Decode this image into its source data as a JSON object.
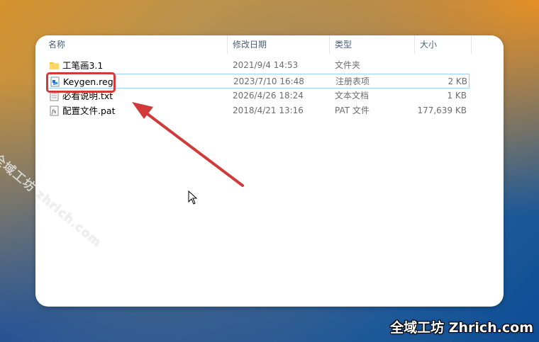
{
  "columns": {
    "name": "名称",
    "date_modified": "修改日期",
    "type": "类型",
    "size": "大小"
  },
  "files": [
    {
      "name": "工笔画3.1",
      "date": "2021/9/4 14:53",
      "type": "文件夹",
      "size": "",
      "icon": "folder-icon"
    },
    {
      "name": "Keygen.reg",
      "date": "2023/7/10 16:48",
      "type": "注册表项",
      "size": "2 KB",
      "icon": "registry-file-icon",
      "selected": true
    },
    {
      "name": "必看说明.txt",
      "date": "2026/4/26 18:24",
      "type": "文本文档",
      "size": "1 KB",
      "icon": "text-file-icon"
    },
    {
      "name": "配置文件.pat",
      "date": "2018/4/21 13:16",
      "type": "PAT 文件",
      "size": "177,639 KB",
      "icon": "pat-file-icon"
    }
  ],
  "watermark": {
    "diagonal": "全域工坊 zhrich.com",
    "corner": "全域工坊 Zhrich.com"
  },
  "colors": {
    "highlight_box": "#d23a3a",
    "arrow": "#d23a3a",
    "selection_border": "#99d1ff",
    "folder": "#f5c242"
  }
}
